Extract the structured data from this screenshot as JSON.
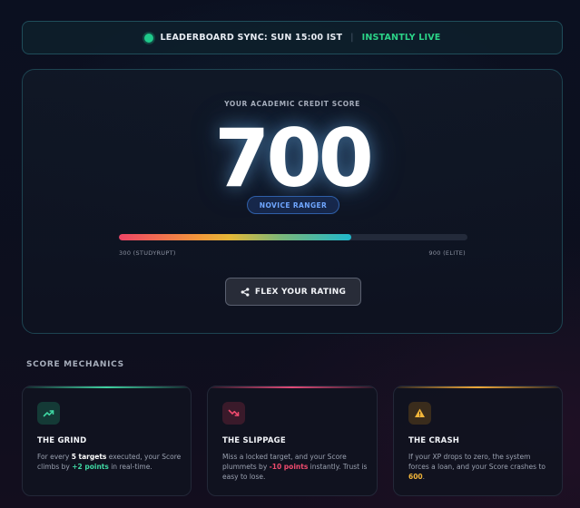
{
  "sync": {
    "label": "LEADERBOARD SYNC: SUN 15:00 IST",
    "separator": "|",
    "status": "INSTANTLY LIVE"
  },
  "score": {
    "caption": "YOUR ACADEMIC CREDIT SCORE",
    "value": "700",
    "rank": "NOVICE RANGER",
    "progress_percent": 66.7,
    "range_min_label": "300 (STUDYRUPT)",
    "range_max_label": "900 (ELITE)",
    "share_button_label": "FLEX YOUR RATING"
  },
  "mechanics": {
    "heading": "SCORE MECHANICS",
    "cards": [
      {
        "icon": "trending-up-icon",
        "title": "THE GRIND",
        "desc_parts": [
          "For every ",
          "5 targets",
          " executed, your Score climbs by ",
          "+2 points",
          " in real-time."
        ]
      },
      {
        "icon": "trending-down-icon",
        "title": "THE SLIPPAGE",
        "desc_parts": [
          "Miss a locked target, and your Score plummets by ",
          "-10 points",
          " instantly. Trust is easy to lose."
        ]
      },
      {
        "icon": "warning-icon",
        "title": "THE CRASH",
        "desc_parts": [
          "If your XP drops to zero, the system forces a loan, and your Score crashes to ",
          "600",
          "."
        ]
      }
    ]
  },
  "colors": {
    "live_green": "#2bd488",
    "rank_blue": "#6fa6ff",
    "grind_accent": "#3fd0a0",
    "slip_accent": "#e24a78",
    "crash_accent": "#f2a83a"
  }
}
